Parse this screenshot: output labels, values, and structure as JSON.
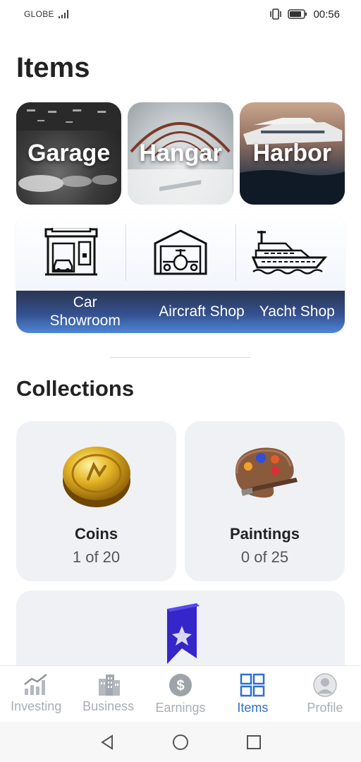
{
  "status_bar": {
    "carrier": "GLOBE",
    "time": "00:56",
    "icons": [
      "signal-icon",
      "vibrate-icon",
      "battery-icon"
    ]
  },
  "page": {
    "title": "Items"
  },
  "locations": [
    {
      "label": "Garage",
      "icon": "garage-photo"
    },
    {
      "label": "Hangar",
      "icon": "hangar-photo"
    },
    {
      "label": "Harbor",
      "icon": "harbor-photo"
    }
  ],
  "shops": [
    {
      "label": "Car Showroom",
      "icon": "car-showroom-icon"
    },
    {
      "label": "Aircraft Shop",
      "icon": "aircraft-hangar-icon"
    },
    {
      "label": "Yacht Shop",
      "icon": "yacht-icon"
    }
  ],
  "collections": {
    "title": "Collections",
    "items": [
      {
        "name": "Coins",
        "count": "1 of 20",
        "icon": "gold-coin-icon"
      },
      {
        "name": "Paintings",
        "count": "0 of 25",
        "icon": "paint-palette-icon"
      }
    ],
    "extra_icon": "nft-bookmark-icon"
  },
  "bottom_nav": {
    "items": [
      {
        "label": "Investing",
        "icon": "chart-icon"
      },
      {
        "label": "Business",
        "icon": "building-icon"
      },
      {
        "label": "Earnings",
        "icon": "dollar-icon"
      },
      {
        "label": "Items",
        "icon": "grid-icon"
      },
      {
        "label": "Profile",
        "icon": "user-icon"
      }
    ],
    "active": "Items"
  },
  "system_nav": [
    "back-icon",
    "home-icon",
    "recents-icon"
  ],
  "colors": {
    "accent": "#2d6fd1",
    "inactive": "#a9adb3",
    "card_bg": "#f0f1f4",
    "shop_bar_top": "#2b3550",
    "shop_bar_bottom": "#4d86d8"
  }
}
